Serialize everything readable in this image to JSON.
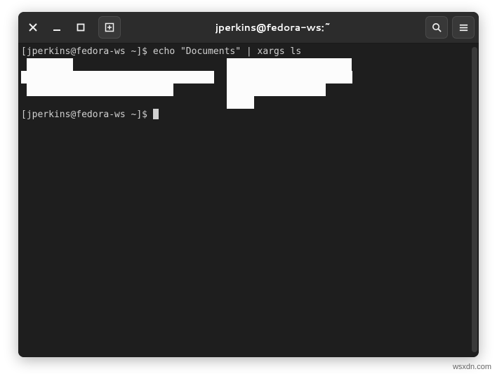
{
  "window": {
    "title": "jperkins@fedora-ws:~"
  },
  "terminal": {
    "prompt1": "[jperkins@fedora-ws ~]$ ",
    "command1": "echo \"Documents\" | xargs ls",
    "prompt2": "[jperkins@fedora-ws ~]$ "
  },
  "icons": {
    "close": "close-icon",
    "minimize": "minimize-icon",
    "maximize": "maximize-icon",
    "newtab": "new-tab-icon",
    "search": "search-icon",
    "menu": "hamburger-menu-icon"
  },
  "watermark": "wsxdn.com"
}
